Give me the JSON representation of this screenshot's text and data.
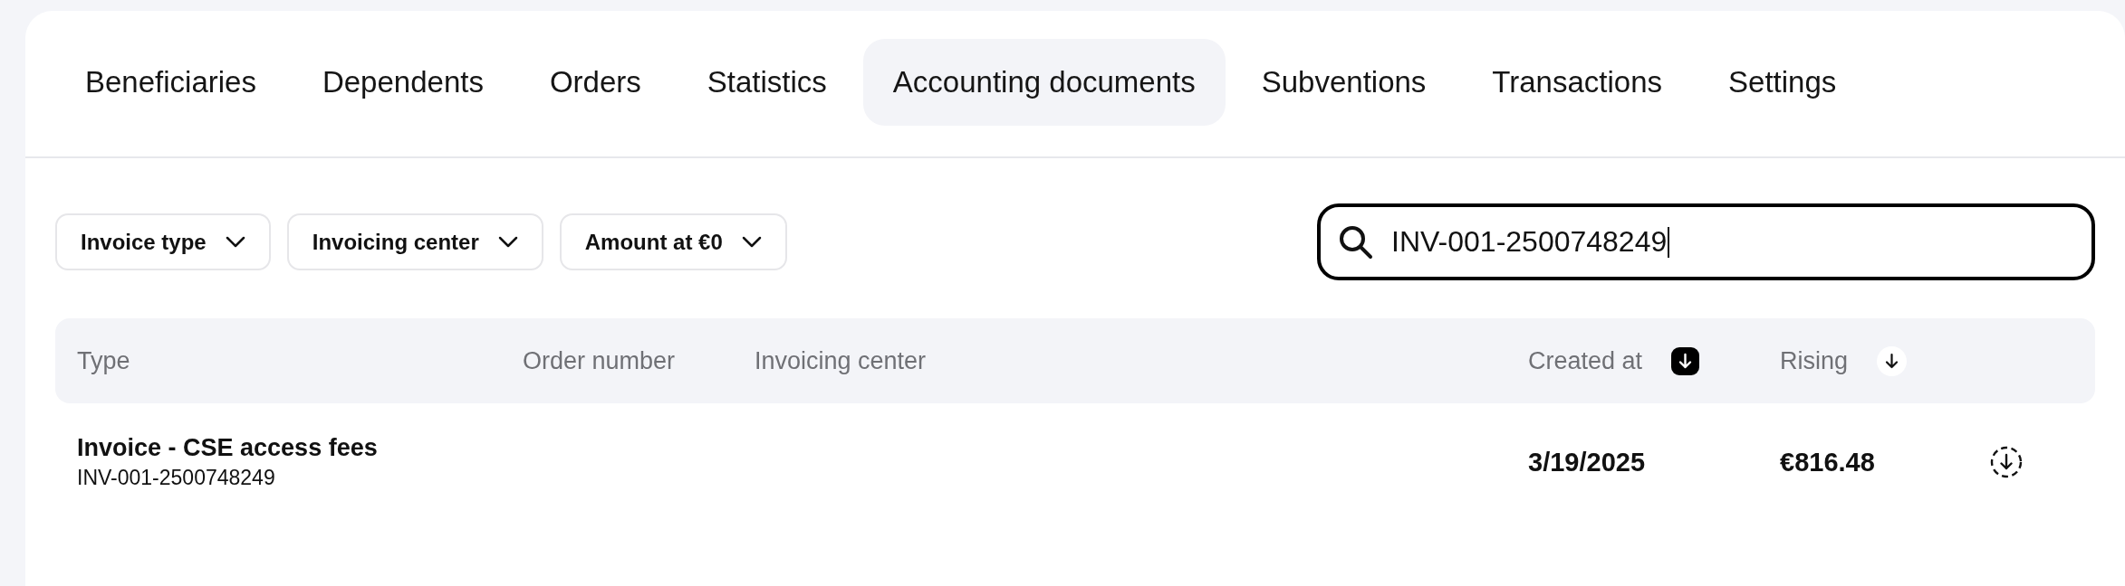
{
  "tabs": [
    {
      "label": "Beneficiaries",
      "selected": false
    },
    {
      "label": "Dependents",
      "selected": false
    },
    {
      "label": "Orders",
      "selected": false
    },
    {
      "label": "Statistics",
      "selected": false
    },
    {
      "label": "Accounting documents",
      "selected": true
    },
    {
      "label": "Subventions",
      "selected": false
    },
    {
      "label": "Transactions",
      "selected": false
    },
    {
      "label": "Settings",
      "selected": false
    }
  ],
  "filters": [
    {
      "label": "Invoice type"
    },
    {
      "label": "Invoicing center"
    },
    {
      "label": "Amount at €0"
    }
  ],
  "search": {
    "value": "INV-001-2500748249"
  },
  "table": {
    "columns": [
      {
        "label": "Type",
        "sortable": false
      },
      {
        "label": "Order number",
        "sortable": false
      },
      {
        "label": "Invoicing center",
        "sortable": false
      },
      {
        "label": "Created at",
        "sortable": true,
        "sort_active": true
      },
      {
        "label": "Rising",
        "sortable": true,
        "sort_active": false
      }
    ],
    "rows": [
      {
        "title": "Invoice - CSE access fees",
        "number": "INV-001-2500748249",
        "created_at": "3/19/2025",
        "amount": "€816.48"
      }
    ]
  }
}
